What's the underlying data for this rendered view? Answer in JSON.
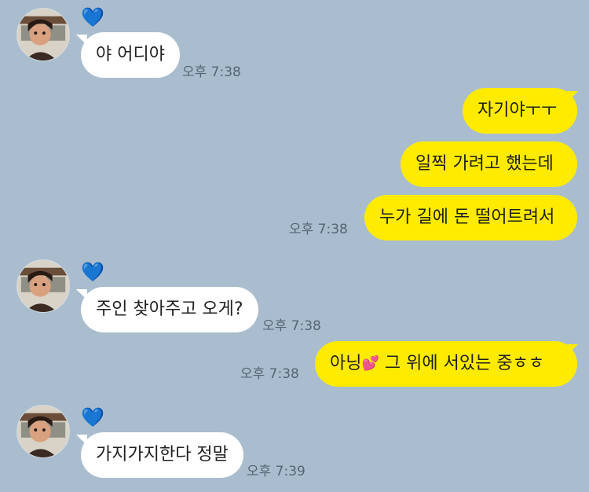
{
  "contact": {
    "name_icon": "💙",
    "avatar": "profile-photo"
  },
  "messages": [
    {
      "side": "left",
      "text": "야 어디야",
      "time": "오후 7:38"
    },
    {
      "side": "right",
      "text": "자기야ㅜㅜ"
    },
    {
      "side": "right",
      "text": "일찍 가려고 했는데"
    },
    {
      "side": "right",
      "text": "누가 길에 돈 떨어트려서",
      "time": "오후 7:38"
    },
    {
      "side": "left",
      "text": "주인 찾아주고 오게?",
      "time": "오후 7:38"
    },
    {
      "side": "right",
      "text_before": "아닝",
      "emoji": "💕",
      "text_after": " 그 위에 서있는 중ㅎㅎ",
      "time": "오후 7:38"
    },
    {
      "side": "left",
      "text": "가지가지한다 정말",
      "time": "오후 7:39"
    }
  ],
  "colors": {
    "background": "#a9bdce",
    "incoming_bubble": "#ffffff",
    "outgoing_bubble": "#ffeb00",
    "timestamp": "#556575",
    "heart": "#1e88ff"
  }
}
